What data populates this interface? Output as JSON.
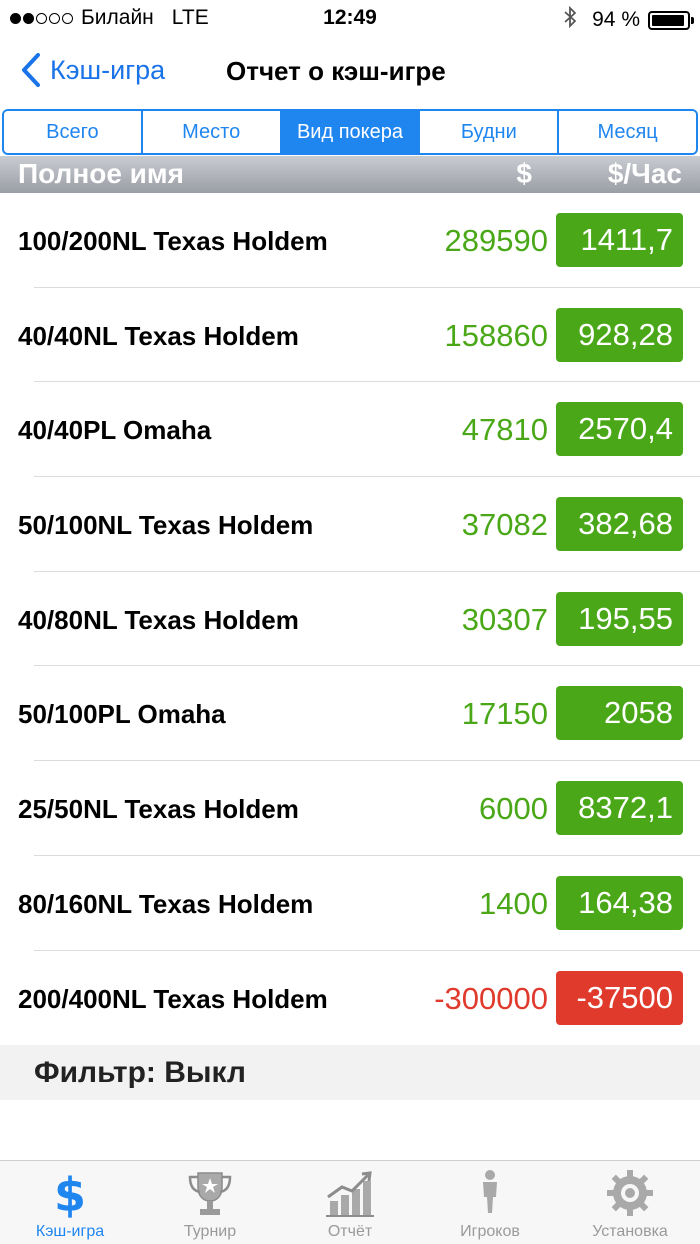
{
  "status_bar": {
    "carrier": "Билайн",
    "network": "LTE",
    "time": "12:49",
    "battery": "94 %",
    "battery_level": 0.94
  },
  "nav": {
    "back_label": "Кэш-игра",
    "title": "Отчет о кэш-игре"
  },
  "tabs_segment": [
    {
      "label": "Всего",
      "active": false
    },
    {
      "label": "Место",
      "active": false
    },
    {
      "label": "Вид покера",
      "active": true
    },
    {
      "label": "Будни",
      "active": false
    },
    {
      "label": "Месяц",
      "active": false
    }
  ],
  "table": {
    "headers": {
      "name": "Полное имя",
      "amount": "$",
      "per_hour": "$/Час"
    },
    "rows": [
      {
        "name": "100/200NL Texas Holdem",
        "amount": "289590",
        "per_hour": "1411,7",
        "positive": true
      },
      {
        "name": "40/40NL Texas Holdem",
        "amount": "158860",
        "per_hour": "928,28",
        "positive": true
      },
      {
        "name": "40/40PL Omaha",
        "amount": "47810",
        "per_hour": "2570,4",
        "positive": true
      },
      {
        "name": "50/100NL Texas Holdem",
        "amount": "37082",
        "per_hour": "382,68",
        "positive": true
      },
      {
        "name": "40/80NL Texas Holdem",
        "amount": "30307",
        "per_hour": "195,55",
        "positive": true
      },
      {
        "name": "50/100PL Omaha",
        "amount": "17150",
        "per_hour": "2058",
        "positive": true
      },
      {
        "name": "25/50NL Texas Holdem",
        "amount": "6000",
        "per_hour": "8372,1",
        "positive": true
      },
      {
        "name": "80/160NL Texas Holdem",
        "amount": "1400",
        "per_hour": "164,38",
        "positive": true
      },
      {
        "name": "200/400NL Texas Holdem",
        "amount": "-300000",
        "per_hour": "-37500",
        "positive": false
      }
    ]
  },
  "filter": {
    "label": "Фильтр: Выкл"
  },
  "colors": {
    "accent": "#1f86f0",
    "positive": "#4aa818",
    "negative": "#e03a2c"
  },
  "tabbar": [
    {
      "label": "Кэш-игра",
      "icon": "dollar-icon",
      "active": true
    },
    {
      "label": "Турнир",
      "icon": "trophy-icon",
      "active": false
    },
    {
      "label": "Отчёт",
      "icon": "chart-icon",
      "active": false
    },
    {
      "label": "Игроков",
      "icon": "player-icon",
      "active": false
    },
    {
      "label": "Установка",
      "icon": "gear-icon",
      "active": false
    }
  ]
}
